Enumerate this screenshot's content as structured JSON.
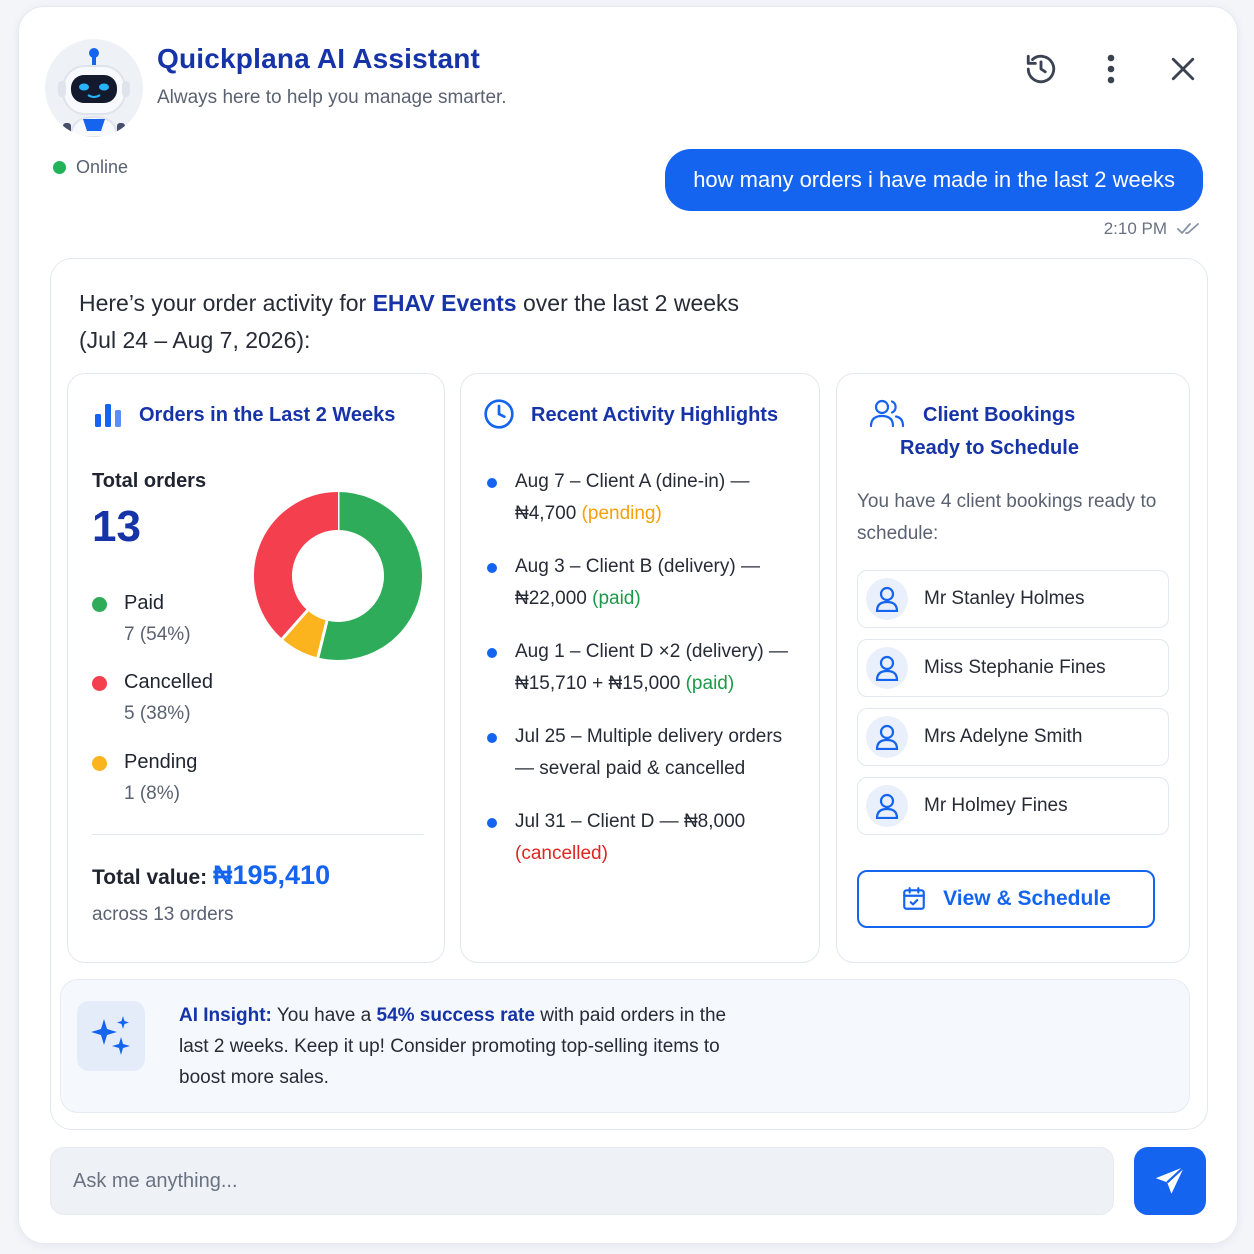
{
  "header": {
    "title": "Quickplana AI Assistant",
    "subtitle": "Always here to help you manage smarter.",
    "status": "Online",
    "icons": [
      "history-icon",
      "more-vertical-icon",
      "close-icon"
    ]
  },
  "conversation": {
    "user_message": "how many orders i have made in the last 2 weeks",
    "timestamp": "2:10 PM"
  },
  "response": {
    "intro_prefix": "Here’s your order activity for ",
    "business": "EHAV Events",
    "intro_suffix": " over the last 2 weeks",
    "intro_range": "(Jul 24 – Aug 7, 2026):",
    "orders_panel": {
      "title": "Orders in the Last 2 Weeks",
      "total_label": "Total orders",
      "total": "13",
      "legend": [
        {
          "name": "Paid",
          "value": "7 (54%)",
          "color": "#2eac5a"
        },
        {
          "name": "Cancelled",
          "value": "5 (38%)",
          "color": "#f43f4e"
        },
        {
          "name": "Pending",
          "value": "1 (8%)",
          "color": "#fbb31e"
        }
      ],
      "total_value_label": "Total value:",
      "total_value": "₦195,410",
      "across": "across 13 orders"
    },
    "activity_panel": {
      "title": "Recent Activity Highlights",
      "items": [
        {
          "text": "Aug 7 – Client A (dine-in) — ₦4,700 ",
          "status": "(pending)",
          "status_type": "pending"
        },
        {
          "text": "Aug 3 – Client B (delivery) — ₦22,000 ",
          "status": "(paid)",
          "status_type": "paid"
        },
        {
          "text": "Aug 1 – Client D ×2 (delivery) — ₦15,710 + ₦15,000 ",
          "status": "(paid)",
          "status_type": "paid"
        },
        {
          "text": "Jul 25 – Multiple delivery orders — several paid & cancelled",
          "status": "",
          "status_type": ""
        },
        {
          "text": "Jul 31 – Client D — ₦8,000 ",
          "status": "(cancelled)",
          "status_type": "cancelled"
        }
      ]
    },
    "bookings_panel": {
      "title_line1": "Client Bookings",
      "title_line2": "Ready to Schedule",
      "intro": "You have 4 client bookings ready to schedule:",
      "clients": [
        "Mr Stanley Holmes",
        "Miss Stephanie Fines",
        "Mrs Adelyne Smith",
        "Mr Holmey Fines"
      ],
      "button": "View & Schedule"
    },
    "insight": {
      "lead": "AI Insight:",
      "pre": " You have a ",
      "rate": "54% success rate",
      "post": " with paid orders in the last 2 weeks. Keep it up! Consider promoting top-selling items to boost more sales."
    }
  },
  "composer": {
    "placeholder": "Ask me anything..."
  },
  "chart_data": {
    "type": "pie",
    "categories": [
      "Paid",
      "Cancelled",
      "Pending"
    ],
    "values": [
      7,
      5,
      1
    ],
    "colors": [
      "#2eac5a",
      "#f43f4e",
      "#fbb31e"
    ],
    "donut": true
  }
}
